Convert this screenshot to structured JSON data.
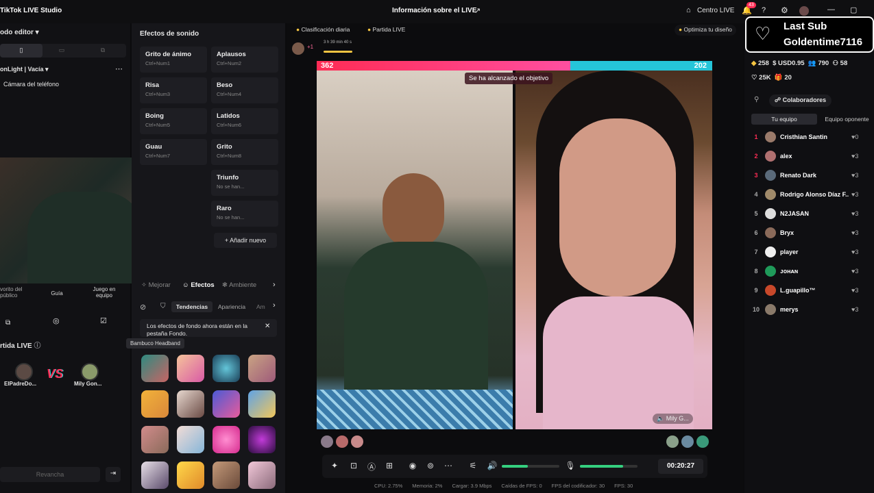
{
  "app": {
    "title": "TikTok LIVE Studio",
    "center_title": "Información sobre el LIVE",
    "centro": "Centro LIVE",
    "notif_count": "43"
  },
  "left": {
    "mode": "odo editor",
    "scene": "onLight | Vacía",
    "camera": "Cámara del teléfono",
    "tools": [
      {
        "label": "vorito del público"
      },
      {
        "label": "Guía"
      },
      {
        "label": "Juego en equipo"
      }
    ],
    "partida": "rtida LIVE",
    "vs_left": "ElPadreDo...",
    "vs_right": "Mily Gon...",
    "rematch": "Revancha"
  },
  "sounds": {
    "title": "Efectos de sonido",
    "items": [
      {
        "name": "Grito de ánimo",
        "key": "Ctrl+Num1"
      },
      {
        "name": "Aplausos",
        "key": "Ctrl+Num2"
      },
      {
        "name": "Risa",
        "key": "Ctrl+Num3"
      },
      {
        "name": "Beso",
        "key": "Ctrl+Num4"
      },
      {
        "name": "Boing",
        "key": "Ctrl+Num5"
      },
      {
        "name": "Latidos",
        "key": "Ctrl+Num6"
      },
      {
        "name": "Guau",
        "key": "Ctrl+Num7"
      },
      {
        "name": "Grito",
        "key": "Ctrl+Num8"
      },
      {
        "name": "Triunfo",
        "key": "No se han..."
      },
      {
        "name": "Raro",
        "key": "No se han..."
      }
    ],
    "add": "Añadir nuevo"
  },
  "effects": {
    "tabs": [
      "Mejorar",
      "Efectos",
      "Ambiente"
    ],
    "subtabs": [
      "Tendencias",
      "Apariencia",
      "Am"
    ],
    "notice": "Los efectos de fondo ahora están en la pestaña Fondo.",
    "tooltip": "Bambuco Headband"
  },
  "live": {
    "daily": "Clasificación diaria",
    "partida": "Partida LIVE",
    "optimize": "Optimiza tu diseño",
    "timer_small": "3 h 39 min 40 s",
    "plus": "+1",
    "score_left": "362",
    "score_right": "202",
    "goal": "Se ha alcanzado el objetivo",
    "opp_name": "Mily G...",
    "time": "00:20:27",
    "volume_level": 0.45,
    "mic_level": 0.75
  },
  "stats": {
    "cpu": "CPU: 2.75%",
    "mem": "Memoria: 2%",
    "load": "Cargar: 3.9 Mbps",
    "drops": "Caídas de FPS: 0",
    "enc": "FPS del codificador: 30",
    "fps": "FPS: 30"
  },
  "right": {
    "last_sub": "Last Sub",
    "sub_name": "Goldentime7116",
    "coins": "258",
    "usd": "USD0.95",
    "viewers": "790",
    "likes_top": "58",
    "likes": "25K",
    "gifts": "20",
    "collab": "Colaboradores",
    "tab1": "Tu equipo",
    "tab2": "Equipo oponente",
    "ranking": [
      {
        "rank": "1",
        "name": "Cristhian Santin",
        "score": "0"
      },
      {
        "rank": "2",
        "name": "alex",
        "score": "3"
      },
      {
        "rank": "3",
        "name": "Renato Dark",
        "score": "3"
      },
      {
        "rank": "4",
        "name": "Rodrigo Alonso Díaz F...",
        "score": "3"
      },
      {
        "rank": "5",
        "name": "N2JASAN",
        "score": "3"
      },
      {
        "rank": "6",
        "name": "Bryx",
        "score": "3"
      },
      {
        "rank": "7",
        "name": "player",
        "score": "3"
      },
      {
        "rank": "8",
        "name": "ᴊᴏʜᴀɴ",
        "score": "3"
      },
      {
        "rank": "9",
        "name": "L.guapillo™",
        "score": "3"
      },
      {
        "rank": "10",
        "name": "merys",
        "score": "3"
      }
    ]
  },
  "colors": {
    "accent": "#fe2c55",
    "cyan": "#25f4ee",
    "green": "#35d07f"
  }
}
